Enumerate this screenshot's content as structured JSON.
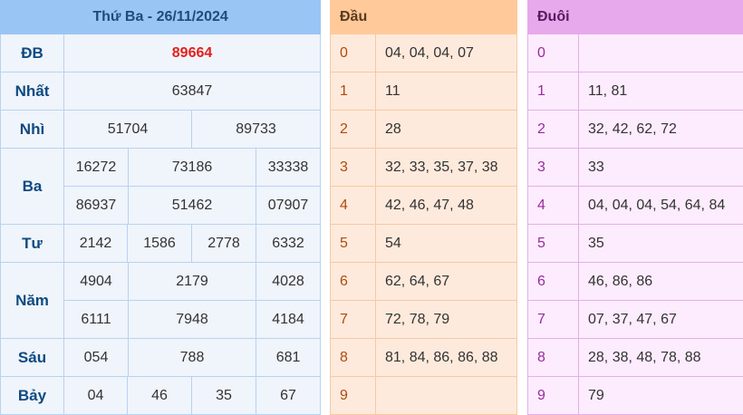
{
  "results": {
    "title": "Thứ Ba - 26/11/2024",
    "labels": {
      "db": "ĐB",
      "nhat": "Nhất",
      "nhi": "Nhì",
      "ba": "Ba",
      "tu": "Tư",
      "nam": "Năm",
      "sau": "Sáu",
      "bay": "Bảy"
    },
    "db": "89664",
    "nhat": "63847",
    "nhi": [
      "51704",
      "89733"
    ],
    "ba": [
      "16272",
      "73186",
      "33338",
      "86937",
      "51462",
      "07907"
    ],
    "tu": [
      "2142",
      "1586",
      "2778",
      "6332"
    ],
    "nam": [
      "4904",
      "2179",
      "4028",
      "6111",
      "7948",
      "4184"
    ],
    "sau": [
      "054",
      "788",
      "681"
    ],
    "bay": [
      "04",
      "46",
      "35",
      "67"
    ]
  },
  "dau": {
    "header": "Đầu",
    "rows": [
      {
        "d": "0",
        "v": "04, 04, 04, 07"
      },
      {
        "d": "1",
        "v": "11"
      },
      {
        "d": "2",
        "v": "28"
      },
      {
        "d": "3",
        "v": "32, 33, 35, 37, 38"
      },
      {
        "d": "4",
        "v": "42, 46, 47, 48"
      },
      {
        "d": "5",
        "v": "54"
      },
      {
        "d": "6",
        "v": "62, 64, 67"
      },
      {
        "d": "7",
        "v": "72, 78, 79"
      },
      {
        "d": "8",
        "v": "81, 84, 86, 86, 88"
      },
      {
        "d": "9",
        "v": ""
      }
    ]
  },
  "duoi": {
    "header": "Đuôi",
    "rows": [
      {
        "d": "0",
        "v": ""
      },
      {
        "d": "1",
        "v": "11, 81"
      },
      {
        "d": "2",
        "v": "32, 42, 62, 72"
      },
      {
        "d": "3",
        "v": "33"
      },
      {
        "d": "4",
        "v": "04, 04, 04, 54, 64, 84"
      },
      {
        "d": "5",
        "v": "35"
      },
      {
        "d": "6",
        "v": "46, 86, 86"
      },
      {
        "d": "7",
        "v": "07, 37, 47, 67"
      },
      {
        "d": "8",
        "v": "28, 38, 48, 78, 88"
      },
      {
        "d": "9",
        "v": "79"
      }
    ]
  }
}
